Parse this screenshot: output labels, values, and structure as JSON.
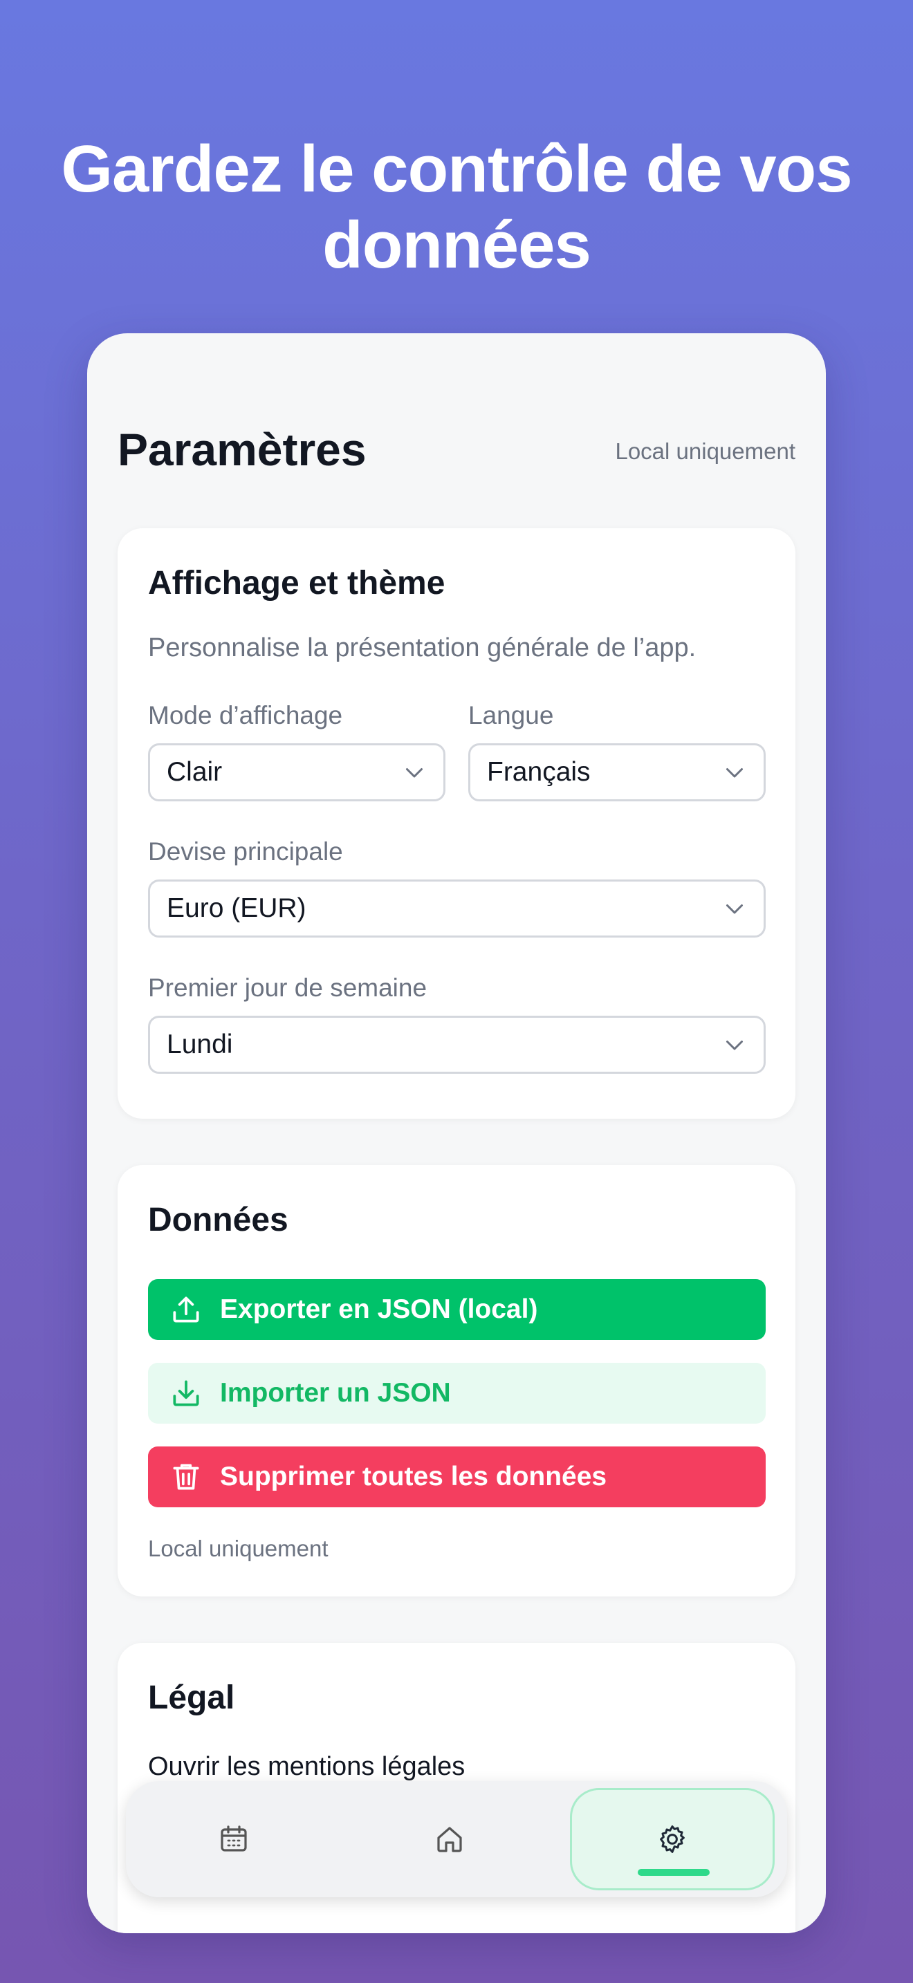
{
  "headline": "Gardez le contrôle de vos données",
  "screen": {
    "title": "Paramètres",
    "subtitle": "Local uniquement"
  },
  "display_card": {
    "title": "Affichage et thème",
    "description": "Personnalise la présentation générale de l’app.",
    "display_mode": {
      "label": "Mode d’affichage",
      "value": "Clair"
    },
    "language": {
      "label": "Langue",
      "value": "Français"
    },
    "currency": {
      "label": "Devise principale",
      "value": "Euro (EUR)"
    },
    "first_day": {
      "label": "Premier jour de semaine",
      "value": "Lundi"
    }
  },
  "data_card": {
    "title": "Données",
    "export_label": "Exporter en JSON (local)",
    "import_label": "Importer un JSON",
    "delete_label": "Supprimer toutes les données",
    "note": "Local uniquement"
  },
  "legal_card": {
    "title": "Légal",
    "link_label": "Ouvrir les mentions légales"
  },
  "tabbar": {
    "items": [
      {
        "icon": "calendar-icon",
        "active": false
      },
      {
        "icon": "home-icon",
        "active": false
      },
      {
        "icon": "gear-icon",
        "active": true
      }
    ]
  },
  "colors": {
    "export": "#00c26a",
    "import_bg": "#e7faf1",
    "delete": "#f43e5f",
    "active_tab": "#2ed98a"
  }
}
